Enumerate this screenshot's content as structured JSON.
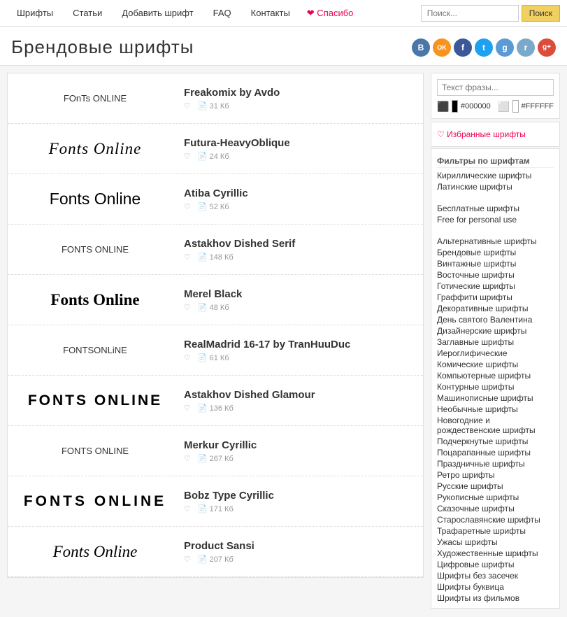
{
  "nav": {
    "links": [
      "Шрифты",
      "Статьи",
      "Добавить шрифт",
      "FAQ",
      "Контакты"
    ],
    "thanks": "❤ Спасибо",
    "search_placeholder": "Поиск...",
    "search_button": "Поиск"
  },
  "header": {
    "title": "Брендовые шрифты"
  },
  "social": [
    {
      "name": "vk",
      "color": "#4a76a8",
      "label": "B"
    },
    {
      "name": "ok",
      "color": "#f7931e",
      "label": "OK"
    },
    {
      "name": "fb",
      "color": "#3b5998",
      "label": "f"
    },
    {
      "name": "tw",
      "color": "#1da1f2",
      "label": "t"
    },
    {
      "name": "gp",
      "color": "#5b9bd5",
      "label": "g"
    },
    {
      "name": "rss",
      "color": "#5b9bd5",
      "label": "r"
    },
    {
      "name": "gplus",
      "color": "#dd4b39",
      "label": "g+"
    }
  ],
  "sidebar": {
    "preview_placeholder": "Текст фразы...",
    "color_dark": "#000000",
    "color_light": "#FFFFFF",
    "favorites_label": "♡ Избранные шрифты",
    "filter_heading": "Фильтры по шрифтам",
    "script_links": [
      "Кириллические шрифты",
      "Латинские шрифты"
    ],
    "free_heading": "",
    "free_links": [
      "Бесплатные шрифты",
      "Free for personal use"
    ],
    "category_links": [
      "Альтернативные шрифты",
      "Брендовые шрифты",
      "Винтажные шрифты",
      "Восточные шрифты",
      "Готические шрифты",
      "Граффити шрифты",
      "Декоративные шрифты",
      "День святого Валентина",
      "Дизайнерские шрифты",
      "Заглавные шрифты",
      "Иероглифические",
      "Комические шрифты",
      "Компьютерные шрифты",
      "Контурные шрифты",
      "Машинописные шрифты",
      "Необычные шрифты",
      "Новогодние и рождественские шрифты",
      "Подчеркнутые шрифты",
      "Поцарапанные шрифты",
      "Праздничные шрифты",
      "Ретро шрифты",
      "Русские шрифты",
      "Рукописные шрифты",
      "Сказочные шрифты",
      "Старославянские шрифты",
      "Трафаретные шрифты",
      "Ужасы шрифты",
      "Художественные шрифты",
      "Цифровые шрифты",
      "Шрифты без засечек",
      "Шрифты буквица",
      "Шрифты из фильмов"
    ]
  },
  "fonts": [
    {
      "id": 1,
      "name": "Freakomix by Avdo",
      "likes": "31 Кб",
      "preview_text": "FOnTs ONLINE",
      "style": "freakomix"
    },
    {
      "id": 2,
      "name": "Futura-HeavyOblique",
      "likes": "24 Кб",
      "preview_text": "Fonts Online",
      "style": "futura"
    },
    {
      "id": 3,
      "name": "Atiba Cyrillic",
      "likes": "52 Кб",
      "preview_text": "Fonts Online",
      "style": "atiba"
    },
    {
      "id": 4,
      "name": "Astakhov Dished Serif",
      "likes": "148 Кб",
      "preview_text": "FONTS ONLINE",
      "style": "astakhov"
    },
    {
      "id": 5,
      "name": "Merel Black",
      "likes": "48 Кб",
      "preview_text": "Fonts Online",
      "style": "merel"
    },
    {
      "id": 6,
      "name": "RealMadrid 16-17 by TranHuuDuc",
      "likes": "61 Кб",
      "preview_text": "FONTSONLiNE",
      "style": "realmadrid"
    },
    {
      "id": 7,
      "name": "Astakhov Dished Glamour",
      "likes": "136 Кб",
      "preview_text": "FONTS ONLINE",
      "style": "astakhov2"
    },
    {
      "id": 8,
      "name": "Merkur Cyrillic",
      "likes": "267 Кб",
      "preview_text": "FONTS ONLINE",
      "style": "merkur"
    },
    {
      "id": 9,
      "name": "Bobz Type Cyrillic",
      "likes": "171 Кб",
      "preview_text": "FONTS ONLINE",
      "style": "bobz"
    },
    {
      "id": 10,
      "name": "Product Sansi",
      "likes": "207 Кб",
      "preview_text": "Fonts Online",
      "style": "product"
    }
  ]
}
